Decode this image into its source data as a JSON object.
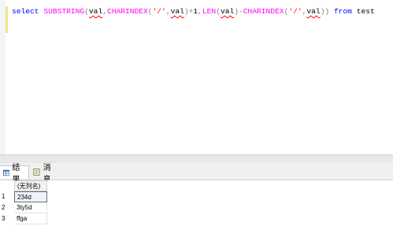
{
  "editor": {
    "tokens": [
      {
        "t": "select",
        "c": "kw"
      },
      {
        "t": " ",
        "c": "id"
      },
      {
        "t": "SUBSTRING",
        "c": "fn"
      },
      {
        "t": "(",
        "c": "op"
      },
      {
        "t": "val",
        "c": "id",
        "sq": true
      },
      {
        "t": ",",
        "c": "op"
      },
      {
        "t": "CHARINDEX",
        "c": "fn"
      },
      {
        "t": "(",
        "c": "op"
      },
      {
        "t": "'/'",
        "c": "str"
      },
      {
        "t": ",",
        "c": "op"
      },
      {
        "t": "val",
        "c": "id",
        "sq": true
      },
      {
        "t": ")+",
        "c": "op"
      },
      {
        "t": "1",
        "c": "id"
      },
      {
        "t": ",",
        "c": "op"
      },
      {
        "t": "LEN",
        "c": "fn"
      },
      {
        "t": "(",
        "c": "op"
      },
      {
        "t": "val",
        "c": "id",
        "sq": true
      },
      {
        "t": ")-",
        "c": "op"
      },
      {
        "t": "CHARINDEX",
        "c": "fn"
      },
      {
        "t": "(",
        "c": "op"
      },
      {
        "t": "'/'",
        "c": "str"
      },
      {
        "t": ",",
        "c": "op"
      },
      {
        "t": "val",
        "c": "id",
        "sq": true
      },
      {
        "t": "))",
        "c": "op"
      },
      {
        "t": " ",
        "c": "id"
      },
      {
        "t": "from",
        "c": "kw"
      },
      {
        "t": " ",
        "c": "id"
      },
      {
        "t": "test",
        "c": "id"
      }
    ]
  },
  "tabs": {
    "results_label": "结果",
    "messages_label": "消息"
  },
  "grid": {
    "column_header": "(无列名)",
    "rows": [
      {
        "num": "1",
        "value": "234d"
      },
      {
        "num": "2",
        "value": "3ty5d"
      },
      {
        "num": "3",
        "value": "ffga"
      }
    ]
  },
  "colors": {
    "keyword": "#0000ff",
    "function": "#ff00ff",
    "string": "#ff0000",
    "operator": "#808080"
  }
}
